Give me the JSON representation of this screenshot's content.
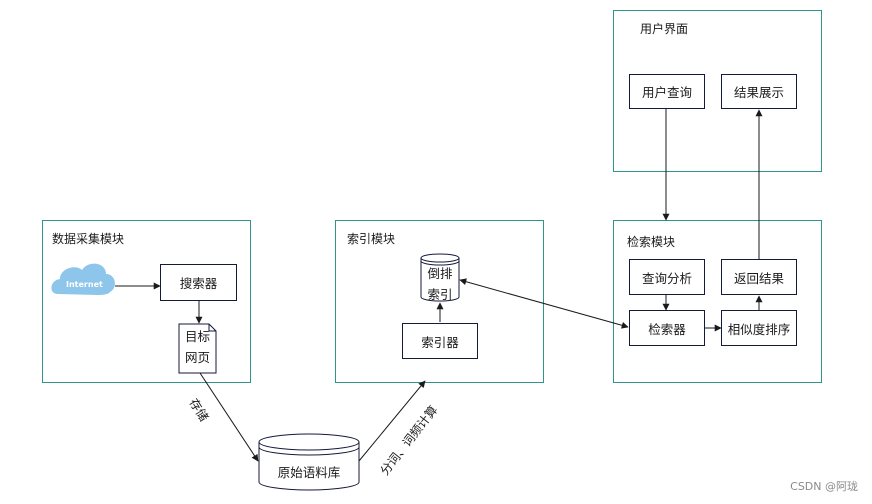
{
  "modules": {
    "data_collection": {
      "title": "数据采集模块"
    },
    "indexing": {
      "title": "索引模块"
    },
    "retrieval": {
      "title": "检索模块"
    },
    "user_interface": {
      "title": "用户界面"
    }
  },
  "nodes": {
    "internet": "Internet",
    "crawler": "搜索器",
    "target_pages_line1": "目标",
    "target_pages_line2": "网页",
    "inverted_index_line1": "倒排",
    "inverted_index_line2": "索引",
    "indexer": "索引器",
    "raw_corpus": "原始语料库",
    "query_analysis": "查询分析",
    "searcher": "检索器",
    "similarity_ranking": "相似度排序",
    "return_results": "返回结果",
    "user_query": "用户查询",
    "result_display": "结果展示"
  },
  "edge_labels": {
    "store": "存储",
    "segmentation": "分词、词频计算"
  },
  "colors": {
    "module_border": "#2e9688",
    "node_border": "#15193b",
    "cloud_fill": "#8ec5ea",
    "edge": "#1a1a1a"
  },
  "watermark": "CSDN @阿珑"
}
